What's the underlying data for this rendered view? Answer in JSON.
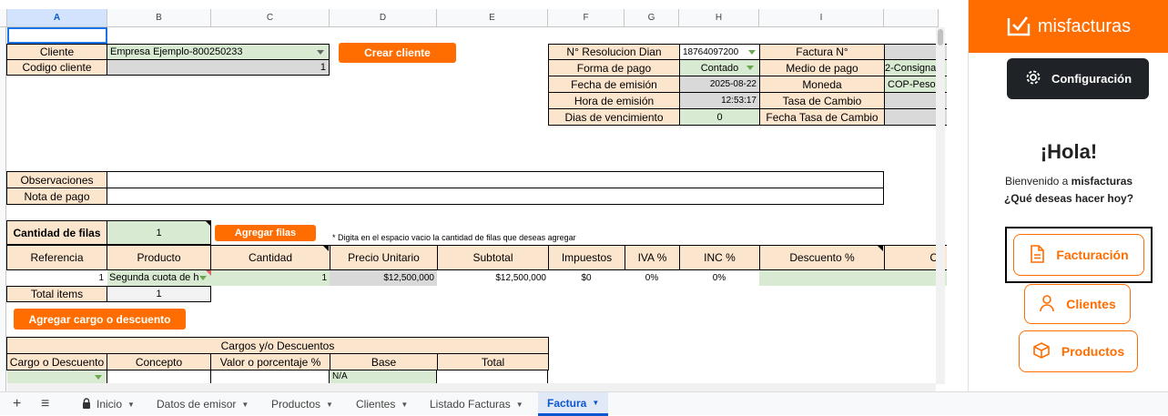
{
  "columns": [
    "A",
    "B",
    "C",
    "D",
    "E",
    "F",
    "G",
    "H",
    "I"
  ],
  "client": {
    "cliente_label": "Cliente",
    "cliente_value": "Empresa Ejemplo-800250233",
    "codigo_label": "Codigo cliente",
    "codigo_value": "1",
    "crear_button": "Crear cliente"
  },
  "invoice": {
    "resolucion_label": "N° Resolucion Dian",
    "resolucion_value": "18764097200",
    "forma_pago_label": "Forma de pago",
    "forma_pago_value": "Contado",
    "fecha_emision_label": "Fecha de emisión",
    "fecha_emision_value": "2025-08-22",
    "hora_emision_label": "Hora de emisión",
    "hora_emision_value": "12:53:17",
    "dias_venc_label": "Dias de vencimiento",
    "dias_venc_value": "0",
    "factura_label": "Factura N°",
    "medio_pago_label": "Medio de pago",
    "medio_pago_value": "2-Consigna",
    "moneda_label": "Moneda",
    "moneda_value": "COP-Peso",
    "tasa_label": "Tasa de Cambio",
    "fecha_tasa_label": "Fecha Tasa de Cambio"
  },
  "notes": {
    "observaciones_label": "Observaciones",
    "nota_pago_label": "Nota de pago"
  },
  "rows_control": {
    "cantidad_label": "Cantidad de filas",
    "cantidad_value": "1",
    "agregar_button": "Agregar filas",
    "hint": "* Digita en el espacio vacio la cantidad de filas que deseas agregar"
  },
  "items_table": {
    "headers": [
      "Referencia",
      "Producto",
      "Cantidad",
      "Precio Unitario",
      "Subtotal",
      "Impuestos",
      "IVA %",
      "INC %",
      "Descuento %",
      "C"
    ],
    "row": [
      "1",
      "Segunda cuota de h",
      "1",
      "$12,500,000",
      "$12,500,000",
      "$0",
      "0%",
      "0%"
    ],
    "total_label": "Total items",
    "total_value": "1"
  },
  "cargo_button": "Agregar cargo o descuento",
  "cargos": {
    "title": "Cargos y/o Descuentos",
    "headers": [
      "Cargo o Descuento",
      "Concepto",
      "Valor o porcentaje %",
      "Base",
      "Total"
    ],
    "base_value": "N/A"
  },
  "tabs": {
    "add": "+",
    "menu": "≡",
    "items": [
      "Inicio",
      "Datos de emisor",
      "Productos",
      "Clientes",
      "Listado Facturas",
      "Factura"
    ]
  },
  "panel": {
    "brand": "misfacturas",
    "config_button": "Configuración",
    "greeting": "¡Hola!",
    "welcome_prefix": "Bienvenido a ",
    "welcome_brand": "misfacturas",
    "question": "¿Qué deseas hacer hoy?",
    "facturacion": "Facturación",
    "clientes": "Clientes",
    "productos": "Productos"
  },
  "colors": {
    "accent": "#ff6d01",
    "label_bg": "#fce5cd",
    "input_green": "#d9ead3",
    "readonly_gray": "#d9d9d9"
  }
}
